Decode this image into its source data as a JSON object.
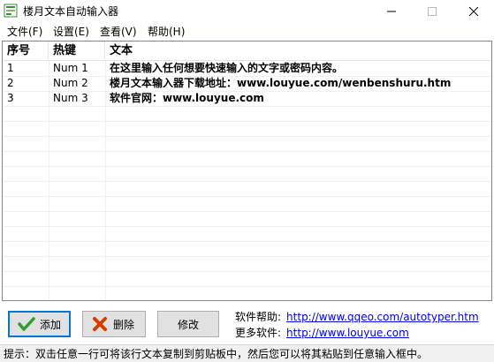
{
  "window": {
    "title": "楼月文本自动输入器",
    "app_icon": "app-icon",
    "minimize_icon": "minimize-icon",
    "maximize_icon": "maximize-icon",
    "close_icon": "close-icon"
  },
  "menu": {
    "items": [
      {
        "label": "文件(F)"
      },
      {
        "label": "设置(E)"
      },
      {
        "label": "查看(V)"
      },
      {
        "label": "帮助(H)"
      }
    ]
  },
  "table": {
    "columns": [
      "序号",
      "热键",
      "文本"
    ],
    "rows": [
      {
        "index": "1",
        "hotkey": "Num 1",
        "text": "在这里输入任何想要快速输入的文字或密码内容。"
      },
      {
        "index": "2",
        "hotkey": "Num 2",
        "text": "楼月文本输入器下载地址：www.louyue.com/wenbenshuru.htm"
      },
      {
        "index": "3",
        "hotkey": "Num 3",
        "text": "软件官网：www.louyue.com"
      }
    ]
  },
  "buttons": {
    "add": {
      "label": "添加",
      "icon": "check-icon",
      "icon_color": "#2e9e2e"
    },
    "delete": {
      "label": "删除",
      "icon": "x-icon",
      "icon_color": "#d83b01"
    },
    "edit": {
      "label": "修改"
    }
  },
  "links": {
    "help_label": "软件帮助:",
    "help_url": "http://www.qqeo.com/autotyper.htm",
    "more_label": "更多软件:",
    "more_url": "http://www.louyue.com"
  },
  "status": {
    "text": "提示：双击任意一行可将该行文本复制到剪贴板中，然后您可以将其粘贴到任意输入框中。"
  },
  "colors": {
    "link": "#0000ee",
    "focus_border": "#0078d7"
  }
}
